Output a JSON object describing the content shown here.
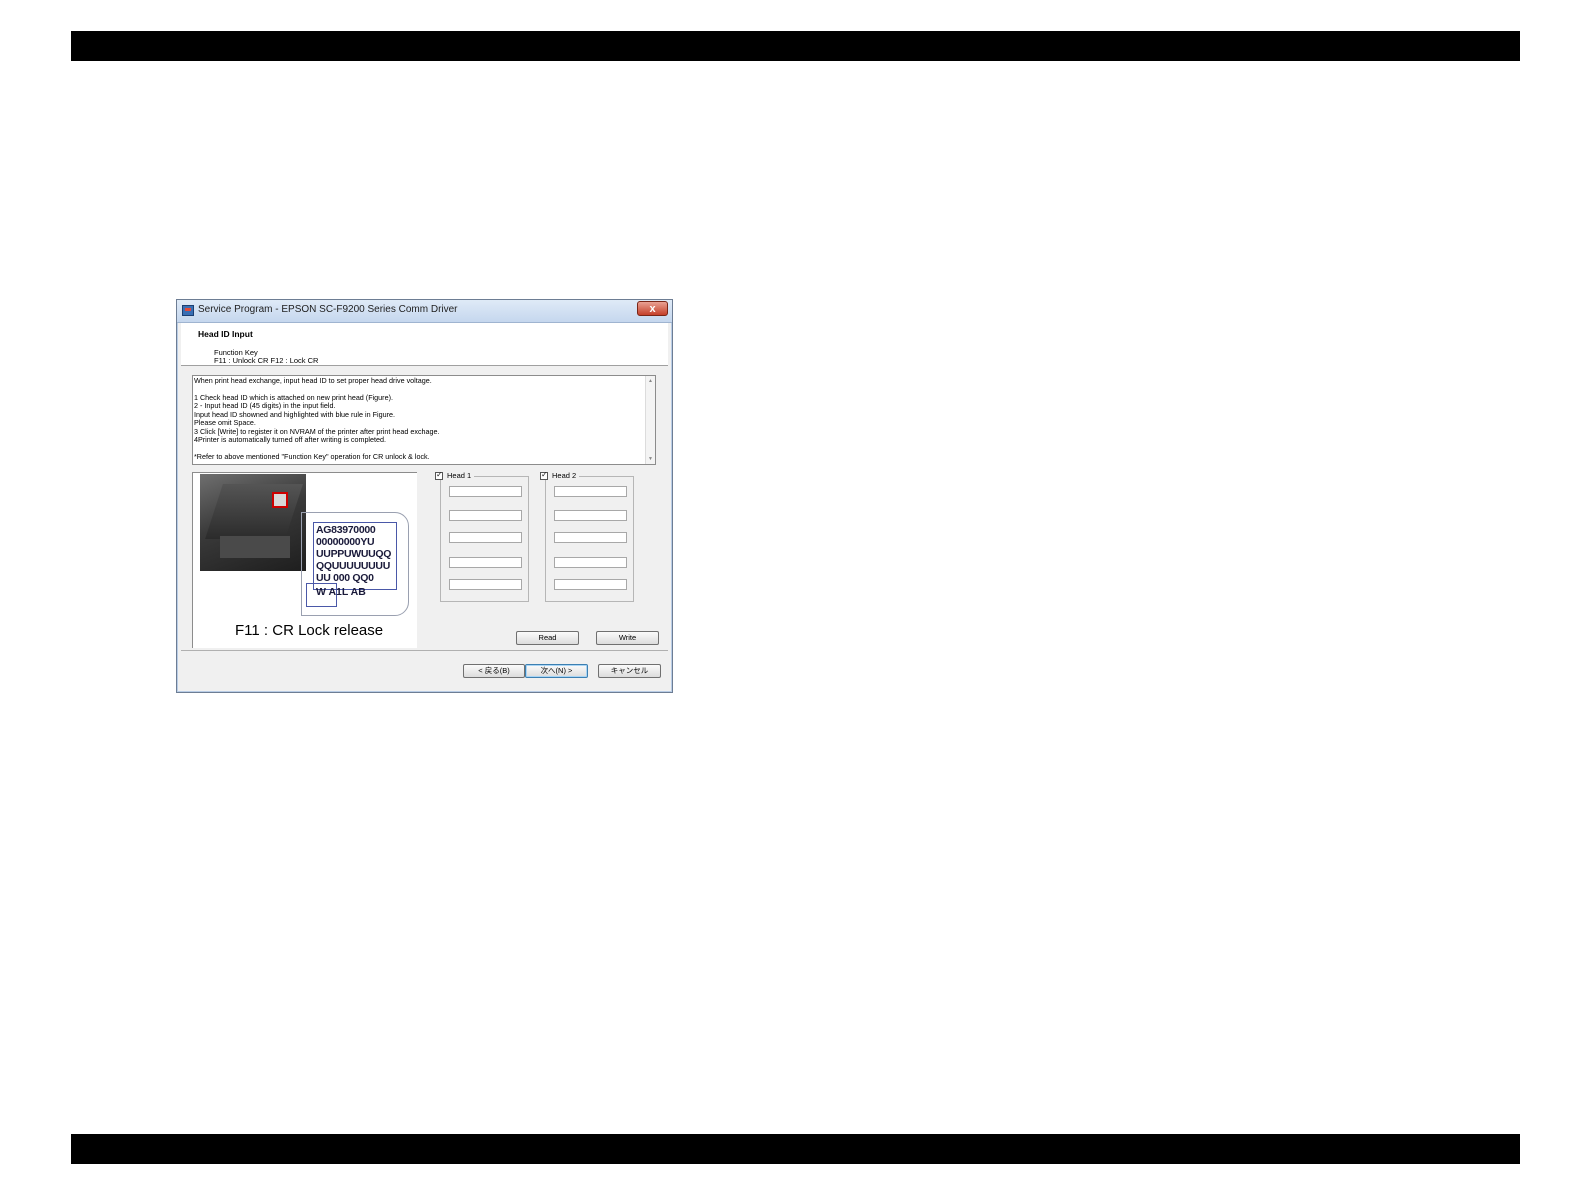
{
  "window": {
    "title": "Service Program - EPSON SC-F9200 Series Comm Driver",
    "close_glyph": "x"
  },
  "header": {
    "title": "Head ID Input",
    "function_key_label": "Function Key",
    "function_key_line": "F11 : Unlock CR   F12 : Lock CR"
  },
  "instructions": [
    "When print head exchange, input head ID to set proper head drive voltage.",
    "",
    "1 Check head ID which is attached on new print head (Figure).",
    "2 - Input head ID (45 digits) in the input field.",
    "Input head ID showned and highlighted with blue rule in Figure.",
    "Please omit Space.",
    "3 Click [Write] to register it on NVRAM of the printer after print head exchage.",
    "4Printer is automatically turned off after writing is completed.",
    "",
    "*Refer to above mentioned \"Function Key\" operation for CR unlock & lock."
  ],
  "figure": {
    "id_lines": [
      "AG83970000",
      "00000000YU",
      "UUPPUWUUQQ",
      "QQUUUUUUUU",
      "UU 000 QQ0"
    ],
    "id_last_line": "W  A1L  AB",
    "caption": "F11 : CR Lock release"
  },
  "head1": {
    "label": "Head 1",
    "checked": true,
    "fields": [
      "",
      "",
      "",
      "",
      ""
    ]
  },
  "head2": {
    "label": "Head 2",
    "checked": true,
    "fields": [
      "",
      "",
      "",
      "",
      ""
    ]
  },
  "buttons": {
    "read": "Read",
    "write": "Write",
    "back": "< 戻る(B)",
    "next": "次へ(N) >",
    "cancel": "キャンセル"
  }
}
